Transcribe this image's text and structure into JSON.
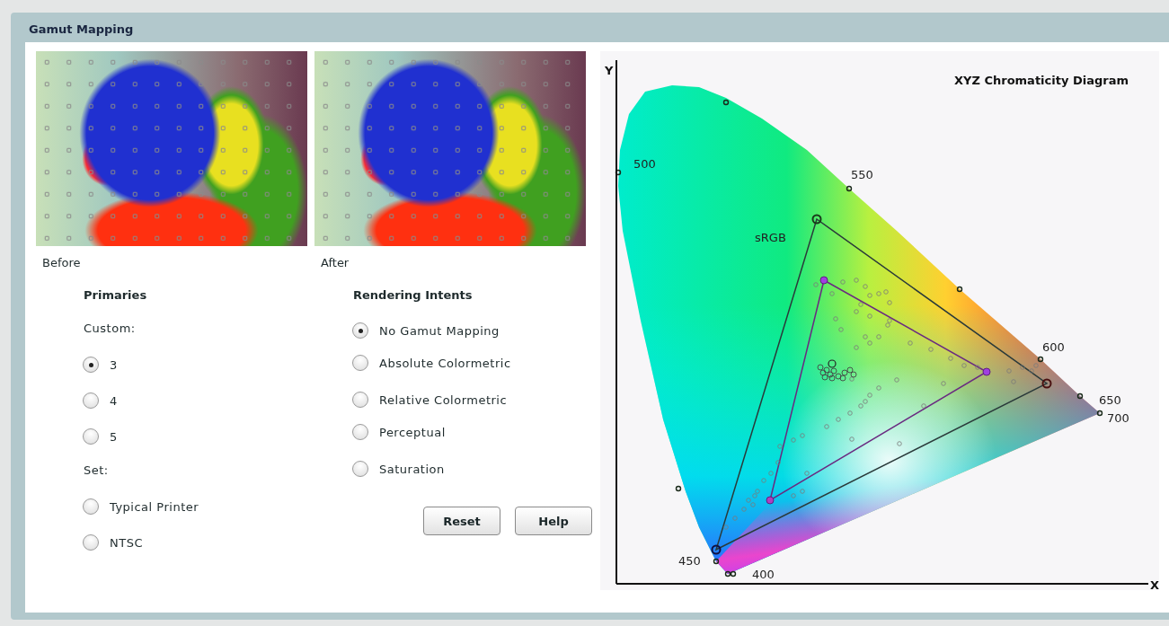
{
  "panel": {
    "title": "Gamut Mapping"
  },
  "previews": [
    {
      "caption": "Before"
    },
    {
      "caption": "After"
    }
  ],
  "primaries": {
    "heading": "Primaries",
    "custom_label": "Custom:",
    "custom_options": [
      {
        "label": "3",
        "selected": true
      },
      {
        "label": "4",
        "selected": false
      },
      {
        "label": "5",
        "selected": false
      }
    ],
    "set_label": "Set:",
    "set_options": [
      {
        "label": "Typical Printer",
        "selected": false
      },
      {
        "label": "NTSC",
        "selected": false
      }
    ]
  },
  "rendering_intents": {
    "heading": "Rendering Intents",
    "groups": [
      {
        "options": [
          {
            "label": "No Gamut Mapping",
            "selected": true
          }
        ]
      },
      {
        "options": [
          {
            "label": "Absolute Colormetric",
            "selected": false
          },
          {
            "label": "Relative Colormetric",
            "selected": false
          }
        ]
      },
      {
        "options": [
          {
            "label": "Perceptual",
            "selected": false
          },
          {
            "label": "Saturation",
            "selected": false
          }
        ]
      }
    ]
  },
  "buttons": [
    "Reset",
    "Help"
  ],
  "diagram": {
    "title": "XYZ Chromaticity Diagram",
    "y_axis": "Y",
    "x_axis": "X",
    "gamut_label": "sRGB",
    "wavelength_labels": [
      "500",
      "550",
      "600",
      "650",
      "700",
      "450",
      "400"
    ]
  }
}
